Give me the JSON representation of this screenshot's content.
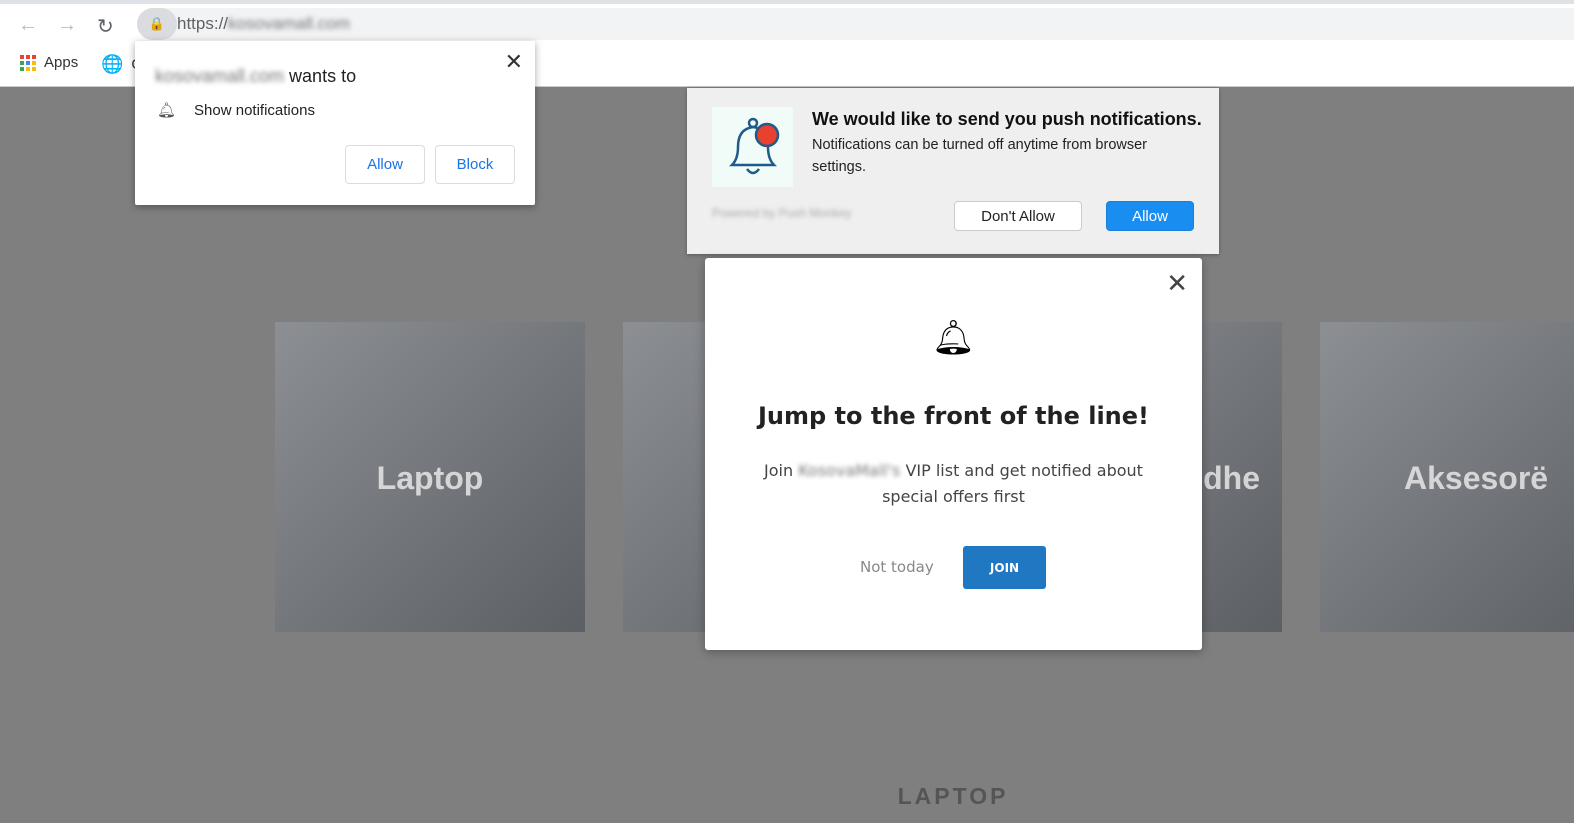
{
  "browser": {
    "url_prefix": "https://",
    "url_domain": "kosovamall.com",
    "bookmarks": [
      {
        "label": "Apps",
        "icon": "apps-grid-icon"
      },
      {
        "label": "G",
        "icon": "globe-icon"
      }
    ]
  },
  "permission_prompt": {
    "domain": "kosovamall.com",
    "title_suffix": " wants to",
    "item": "Show notifications",
    "allow": "Allow",
    "block": "Block"
  },
  "push_prompt": {
    "title": "We would like to send you push notifications.",
    "body": "Notifications can be turned off anytime from browser settings.",
    "powered": "Powered by Push Monkey",
    "dont_allow": "Don't Allow",
    "allow": "Allow",
    "accent": "#1a8ef0"
  },
  "modal": {
    "title": "Jump to the front of the line!",
    "msg_pre": "Join ",
    "msg_brand": "KosovaMall's",
    "msg_post": " VIP list and get notified about special offers first",
    "not_today": "Not today",
    "join": "JOIN",
    "join_color": "#1f78c1"
  },
  "categories": [
    {
      "label": "Laptop"
    },
    {
      "label": ""
    },
    {
      "label": "dhe"
    },
    {
      "label": "Aksesorë"
    }
  ],
  "section_title": "LAPTOP"
}
